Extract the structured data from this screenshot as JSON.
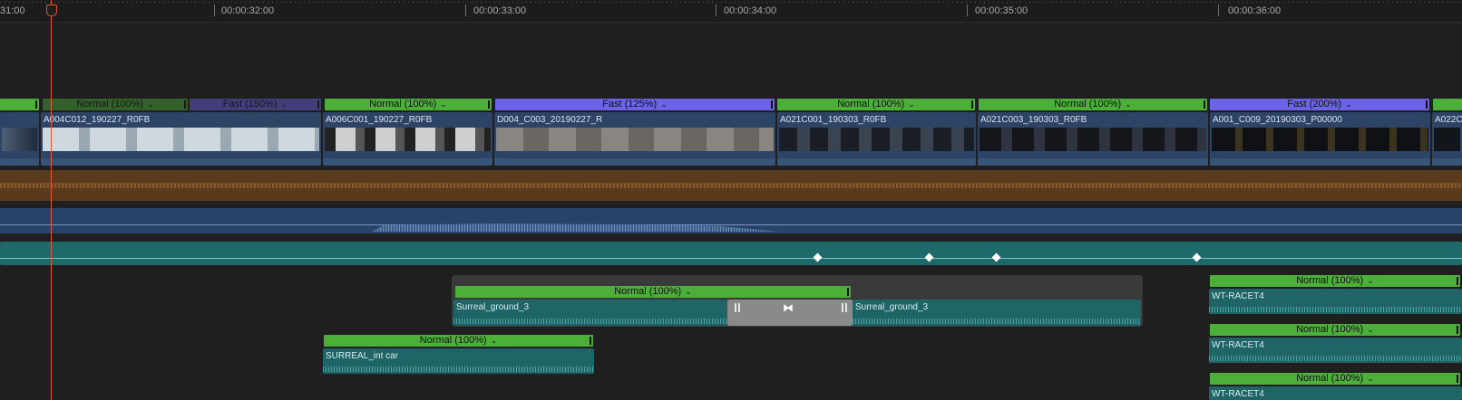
{
  "ruler": {
    "timecodes": [
      "31:00",
      "00:00:32:00",
      "00:00:33:00",
      "00:00:34:00",
      "00:00:35:00",
      "00:00:36:00"
    ]
  },
  "primary_storyline": {
    "speed_bars": [
      {
        "label": "",
        "color": "#4caf3a"
      },
      {
        "label": "Normal (100%)",
        "color": "#4caf3a",
        "dimmed": true
      },
      {
        "label": "Fast (150%)",
        "color": "#6b64e6",
        "dimmed": true
      },
      {
        "label": "Normal (100%)",
        "color": "#4caf3a"
      },
      {
        "label": "Fast (125%)",
        "color": "#6b64e6"
      },
      {
        "label": "Normal (100%)",
        "color": "#4caf3a"
      },
      {
        "label": "Normal (100%)",
        "color": "#4caf3a"
      },
      {
        "label": "Fast (200%)",
        "color": "#6b64e6"
      },
      {
        "label": "",
        "color": "#4caf3a"
      }
    ],
    "clips": [
      {
        "name": ""
      },
      {
        "name": "A004C012_190227_R0FB"
      },
      {
        "name": "A006C001_190227_R0FB"
      },
      {
        "name": "D004_C003_20190227_R"
      },
      {
        "name": "A021C001_190303_R0FB"
      },
      {
        "name": "A021C003_190303_R0FB"
      },
      {
        "name": "A001_C009_20190303_P00000"
      },
      {
        "name": "A022C"
      }
    ]
  },
  "connected_clips": {
    "compound": {
      "speed_label": "Normal (100%)",
      "left_clip": "Surreal_ground_3",
      "right_clip": "Surreal_ground_3"
    },
    "interior": {
      "speed_label": "Normal (100%)",
      "clip": "SURREAL_int car"
    },
    "race_clips": [
      {
        "speed_label": "Normal (100%)",
        "clip": "WT-RACET4"
      },
      {
        "speed_label": "Normal (100%)",
        "clip": "WT-RACET4"
      },
      {
        "speed_label": "Normal (100%)",
        "clip": "WT-RACET4"
      }
    ]
  },
  "colors": {
    "playhead": "#e05a3a",
    "speed_normal": "#4caf3a",
    "speed_fast": "#6b64e6",
    "video_clip": "#2d4466",
    "audio_clip": "#1f6466"
  }
}
